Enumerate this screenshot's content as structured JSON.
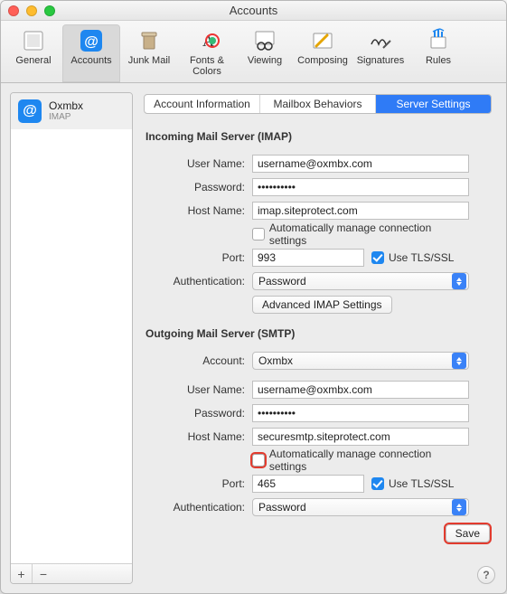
{
  "window": {
    "title": "Accounts"
  },
  "toolbar": {
    "items": [
      {
        "id": "general",
        "label": "General"
      },
      {
        "id": "accounts",
        "label": "Accounts",
        "selected": true
      },
      {
        "id": "junk",
        "label": "Junk Mail"
      },
      {
        "id": "fonts",
        "label": "Fonts & Colors"
      },
      {
        "id": "viewing",
        "label": "Viewing"
      },
      {
        "id": "composing",
        "label": "Composing"
      },
      {
        "id": "signatures",
        "label": "Signatures"
      },
      {
        "id": "rules",
        "label": "Rules"
      }
    ]
  },
  "sidebar": {
    "accounts": [
      {
        "name": "Oxmbx",
        "protocol": "IMAP"
      }
    ],
    "add_label": "+",
    "remove_label": "−"
  },
  "tabs": {
    "items": [
      {
        "id": "info",
        "label": "Account Information"
      },
      {
        "id": "mailbox",
        "label": "Mailbox Behaviors"
      },
      {
        "id": "server",
        "label": "Server Settings",
        "active": true
      }
    ]
  },
  "incoming": {
    "section_title": "Incoming Mail Server (IMAP)",
    "labels": {
      "username": "User Name:",
      "password": "Password:",
      "hostname": "Host Name:",
      "port": "Port:",
      "auth": "Authentication:"
    },
    "values": {
      "username": "username@oxmbx.com",
      "password": "••••••••••",
      "hostname": "imap.siteprotect.com",
      "auto_manage": false,
      "auto_manage_label": "Automatically manage connection settings",
      "port": "993",
      "tls": true,
      "tls_label": "Use TLS/SSL",
      "auth": "Password",
      "advanced_label": "Advanced IMAP Settings"
    }
  },
  "outgoing": {
    "section_title": "Outgoing Mail Server (SMTP)",
    "labels": {
      "account": "Account:",
      "username": "User Name:",
      "password": "Password:",
      "hostname": "Host Name:",
      "port": "Port:",
      "auth": "Authentication:"
    },
    "values": {
      "account": "Oxmbx",
      "username": "username@oxmbx.com",
      "password": "••••••••••",
      "hostname": "securesmtp.siteprotect.com",
      "auto_manage": false,
      "auto_manage_label": "Automatically manage connection settings",
      "port": "465",
      "tls": true,
      "tls_label": "Use TLS/SSL",
      "auth": "Password"
    }
  },
  "buttons": {
    "save": "Save"
  },
  "help": {
    "label": "?"
  }
}
